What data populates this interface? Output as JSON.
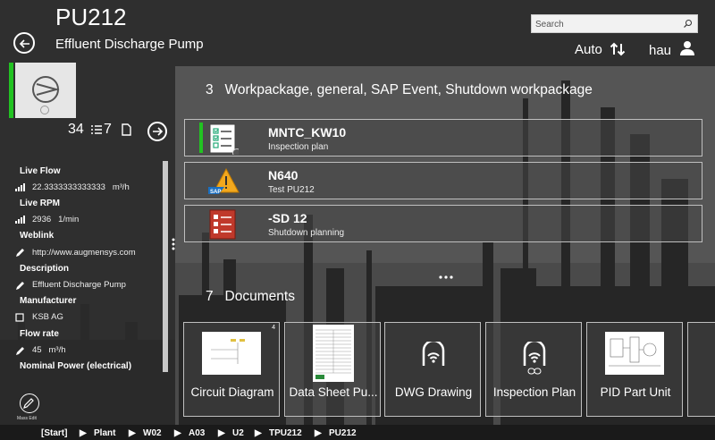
{
  "header": {
    "title": "PU212",
    "subtitle": "Effluent Discharge Pump",
    "search_placeholder": "Search",
    "mode_label": "Auto",
    "user_name": "hau"
  },
  "asset": {
    "count_a": "34",
    "count_b": "7",
    "status_color": "#22c322"
  },
  "properties": [
    {
      "label": "Live Flow",
      "icon": "signal-icon",
      "value": "22.3333333333333",
      "unit": "m³/h"
    },
    {
      "label": "Live RPM",
      "icon": "signal-icon",
      "value": "2936",
      "unit": "1/min"
    },
    {
      "label": "Weblink",
      "icon": "pencil-icon",
      "value": "http://www.augmensys.com",
      "unit": ""
    },
    {
      "label": "Description",
      "icon": "pencil-icon",
      "value": "Effluent Discharge Pump",
      "unit": ""
    },
    {
      "label": "Manufacturer",
      "icon": "checkbox-icon",
      "value": "KSB AG",
      "unit": ""
    },
    {
      "label": "Flow rate",
      "icon": "pencil-icon",
      "value": "45",
      "unit": "m³/h"
    },
    {
      "label": "Nominal Power (electrical)",
      "icon": "",
      "value": "",
      "unit": ""
    }
  ],
  "mass_edit_label": "Mass Edit",
  "workpackages": {
    "count": "3",
    "heading": "Workpackage, general, SAP Event, Shutdown workpackage",
    "items": [
      {
        "name": "MNTC_KW10",
        "desc": "Inspection plan",
        "icon": "checklist-icon"
      },
      {
        "name": "N640",
        "desc": "Test PU212",
        "icon": "sap-warning-icon"
      },
      {
        "name": "-SD 12",
        "desc": "Shutdown planning",
        "icon": "shutdown-list-icon"
      }
    ]
  },
  "documents": {
    "count": "7",
    "heading": "Documents",
    "first_badge": "4",
    "items": [
      {
        "name": "Circuit Diagram"
      },
      {
        "name": "Data Sheet Pu..."
      },
      {
        "name": "DWG Drawing"
      },
      {
        "name": "Inspection Plan"
      },
      {
        "name": "PID Part Unit"
      }
    ]
  },
  "breadcrumb": [
    "[Start]",
    "Plant",
    "W02",
    "A03",
    "U2",
    "TPU212",
    "PU212"
  ],
  "colors": {
    "accent_green": "#22c322",
    "panel_bg": "#333333"
  }
}
